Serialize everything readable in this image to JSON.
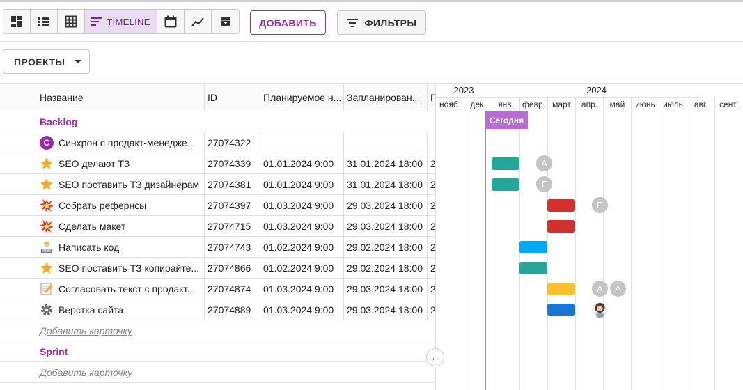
{
  "toolbar": {
    "views": [
      {
        "name": "dashboard-view",
        "icon": "dashboard-icon"
      },
      {
        "name": "list-view",
        "icon": "list-icon"
      },
      {
        "name": "table-view",
        "icon": "table-grid-icon"
      },
      {
        "name": "timeline-view",
        "icon": "timeline-icon",
        "label": "TIMELINE",
        "active": true
      },
      {
        "name": "calendar-view",
        "icon": "calendar-icon"
      },
      {
        "name": "chart-view",
        "icon": "line-chart-icon"
      },
      {
        "name": "archive-view",
        "icon": "archive-icon"
      }
    ],
    "add_label": "ДОБАВИТЬ",
    "filters_label": "ФИЛЬТРЫ"
  },
  "projects_label": "ПРОЕКТЫ",
  "grid": {
    "columns": [
      "Название",
      "ID",
      "Планируемое н...",
      "Запланирован...",
      "Р"
    ],
    "groups": [
      {
        "title": "Backlog",
        "rows": [
          {
            "icon": "avatar-c-icon",
            "icon_letter": "C",
            "name": "Синхрон с продакт-менедже...",
            "id": "27074322",
            "start": "",
            "end": "",
            "extra": ""
          },
          {
            "icon": "star-icon",
            "name": "SEO делают ТЗ",
            "id": "27074339",
            "start": "01.01.2024 9:00",
            "end": "31.01.2024 18:00",
            "extra": "2"
          },
          {
            "icon": "star-icon",
            "name": "SEO поставить ТЗ дизайнерам",
            "id": "27074381",
            "start": "01.01.2024 9:00",
            "end": "31.01.2024 18:00",
            "extra": "2"
          },
          {
            "icon": "explosion-icon",
            "name": "Собрать рефернсы",
            "id": "27074397",
            "start": "01.03.2024 9:00",
            "end": "29.03.2024 18:00",
            "extra": "2"
          },
          {
            "icon": "explosion-icon",
            "name": "Сделать макет",
            "id": "27074715",
            "start": "01.03.2024 9:00",
            "end": "29.03.2024 18:00",
            "extra": "2"
          },
          {
            "icon": "developer-icon",
            "name": "Написать код",
            "id": "27074743",
            "start": "01.02.2024 9:00",
            "end": "29.02.2024 18:00",
            "extra": "2"
          },
          {
            "icon": "star-icon",
            "name": "SEO поставить ТЗ копирайте...",
            "id": "27074866",
            "start": "01.02.2024 9:00",
            "end": "29.02.2024 18:00",
            "extra": "2"
          },
          {
            "icon": "memo-icon",
            "name": "Согласовать текст с продакт...",
            "id": "27074874",
            "start": "01.03.2024 9:00",
            "end": "29.03.2024 18:00",
            "extra": "2"
          },
          {
            "icon": "gear-icon",
            "name": "Верстка сайта",
            "id": "27074889",
            "start": "01.03.2024 9:00",
            "end": "29.03.2024 18:00",
            "extra": "2"
          }
        ],
        "add_card": "Добавить карточку"
      },
      {
        "title": "Sprint",
        "rows": [],
        "add_card": "Добавить карточку"
      }
    ]
  },
  "timeline": {
    "years": [
      "2023",
      "2024"
    ],
    "months": [
      "нояб.",
      "дек.",
      "янв.",
      "февр.",
      "март",
      "апр.",
      "май",
      "июнь",
      "июль",
      "авг.",
      "сент."
    ],
    "today_label": "Сегодня",
    "bars": [
      {
        "row": 1,
        "start_month": "янв.",
        "color": "#26a69a",
        "avatars": [
          "А"
        ]
      },
      {
        "row": 2,
        "start_month": "янв.",
        "color": "#26a69a",
        "avatars": [
          "Г"
        ]
      },
      {
        "row": 3,
        "start_month": "март",
        "color": "#d32f2f",
        "avatars": [
          "П"
        ]
      },
      {
        "row": 4,
        "start_month": "март",
        "color": "#d32f2f",
        "avatars": []
      },
      {
        "row": 5,
        "start_month": "февр.",
        "color": "#03a9f4",
        "avatars": []
      },
      {
        "row": 6,
        "start_month": "февр.",
        "color": "#26a69a",
        "avatars": []
      },
      {
        "row": 7,
        "start_month": "март",
        "color": "#fbc02d",
        "avatars": [
          "А",
          "А"
        ]
      },
      {
        "row": 8,
        "start_month": "март",
        "color": "#1976d2",
        "avatars": [
          "photo"
        ]
      }
    ]
  }
}
